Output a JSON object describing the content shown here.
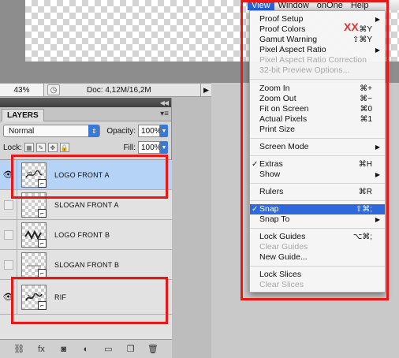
{
  "menubar": {
    "items": [
      "View",
      "Window",
      "onOne",
      "Help"
    ],
    "active": "View"
  },
  "view_menu": {
    "items": [
      {
        "label": "Proof Setup",
        "submenu": true
      },
      {
        "label": "Proof Colors",
        "shortcut": "⌘Y"
      },
      {
        "label": "Gamut Warning",
        "shortcut": "⇧⌘Y"
      },
      {
        "label": "Pixel Aspect Ratio",
        "submenu": true
      },
      {
        "label": "Pixel Aspect Ratio Correction",
        "disabled": true
      },
      {
        "label": "32-bit Preview Options...",
        "disabled": true
      },
      {
        "label": "Zoom In",
        "shortcut": "⌘+"
      },
      {
        "label": "Zoom Out",
        "shortcut": "⌘−"
      },
      {
        "label": "Fit on Screen",
        "shortcut": "⌘0"
      },
      {
        "label": "Actual Pixels",
        "shortcut": "⌘1"
      },
      {
        "label": "Print Size"
      },
      {
        "label": "Screen Mode",
        "submenu": true
      },
      {
        "label": "Extras",
        "shortcut": "⌘H",
        "checked": true
      },
      {
        "label": "Show",
        "submenu": true
      },
      {
        "label": "Rulers",
        "shortcut": "⌘R"
      },
      {
        "label": "Snap",
        "shortcut": "⇧⌘;",
        "checked": true,
        "highlighted": true
      },
      {
        "label": "Snap To",
        "submenu": true
      },
      {
        "label": "Lock Guides",
        "shortcut": "⌥⌘;"
      },
      {
        "label": "Clear Guides",
        "disabled": true
      },
      {
        "label": "New Guide..."
      },
      {
        "label": "Lock Slices"
      },
      {
        "label": "Clear Slices",
        "disabled": true
      }
    ],
    "watermark": "XX"
  },
  "status_bar": {
    "zoom": "43%",
    "doc_info": "Doc: 4,12M/16,2M"
  },
  "layers_panel": {
    "tab_label": "LAYERS",
    "blend_mode": "Normal",
    "opacity_label": "Opacity:",
    "opacity_value": "100%",
    "lock_label": "Lock:",
    "fill_label": "Fill:",
    "fill_value": "100%",
    "layers": [
      {
        "name": "LOGO FRONT A",
        "visible": true,
        "selected": true
      },
      {
        "name": "SLOGAN FRONT A",
        "visible": false,
        "selected": false
      },
      {
        "name": "LOGO FRONT B",
        "visible": false,
        "selected": false
      },
      {
        "name": "SLOGAN FRONT B",
        "visible": false,
        "selected": false
      },
      {
        "name": "RIF",
        "visible": true,
        "selected": false
      }
    ]
  },
  "colors": {
    "highlight_red": "#e81818",
    "menu_selection": "#2f68da",
    "layer_selection": "#b5d3f7"
  }
}
